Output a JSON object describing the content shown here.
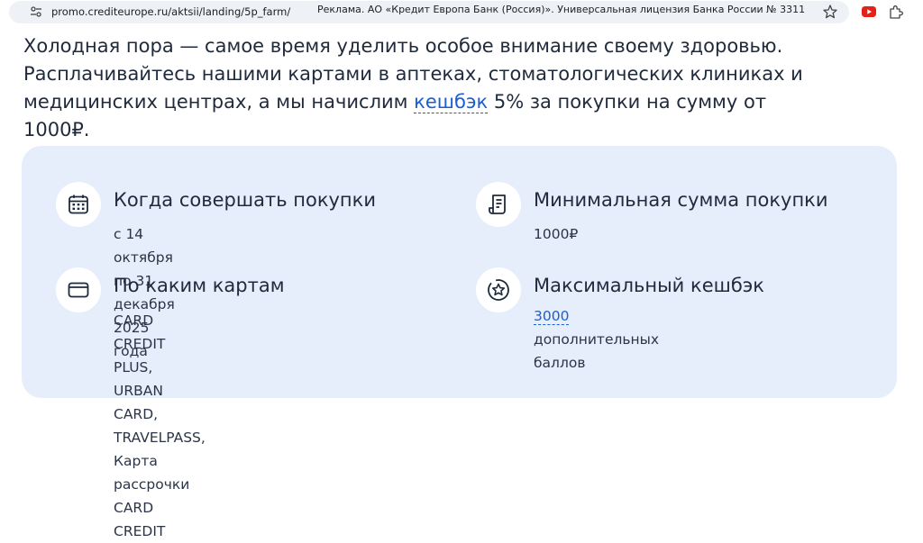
{
  "browser": {
    "url": "promo.crediteurope.ru/aktsii/landing/5p_farm/",
    "ad_notice": "Реклама. АО «Кредит Европа Банк (Россия)». Универсальная лицензия Банка России № 3311",
    "icons": [
      "tune-icon",
      "star-icon",
      "youtube-icon",
      "extensions-icon"
    ]
  },
  "intro": {
    "line1": "Холодная пора — самое время уделить особое внимание своему здоровью.",
    "line2": "Расплачивайтесь нашими картами в аптеках, стоматологических клиниках и",
    "line3_before": "медицинских центрах, а мы начислим ",
    "link": "кешбэк",
    "line3_after": " 5% за покупки на сумму от 1000₽."
  },
  "info": {
    "when": {
      "icon": "calendar-icon",
      "title": "Когда совершать покупки",
      "text": "с 14 октября по 31 декабря 2025 года"
    },
    "min_sum": {
      "icon": "receipt-icon",
      "title": "Минимальная сумма покупки",
      "text": "1000₽"
    },
    "cards": {
      "icon": "credit-card-icon",
      "title": "По каким картам",
      "line1": "CARD CREDIT PLUS, URBAN CARD,",
      "line2": "TRAVELPASS, Карта рассрочки",
      "line3": "CARD CREDIT"
    },
    "max_cashback": {
      "icon": "star-badge-icon",
      "title": "Максимальный кешбэк",
      "link": "3000",
      "text_after": " дополнительных баллов"
    }
  },
  "colors": {
    "accent": "#1a5fd0",
    "panel_bg": "#e7eefb",
    "text": "#1f2a3c"
  }
}
